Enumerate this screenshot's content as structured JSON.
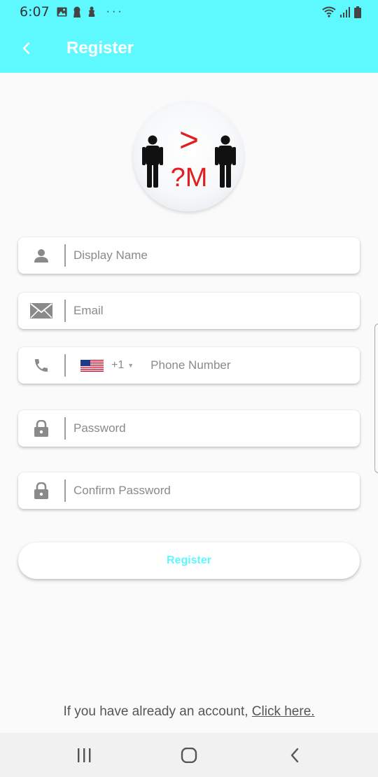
{
  "status_bar": {
    "time": "6:07",
    "left_icons": [
      "gallery-icon",
      "keyhole-icon",
      "figure-icon"
    ],
    "more": "···",
    "right_icons": [
      "wifi-icon",
      "signal-icon",
      "battery-icon"
    ]
  },
  "app_bar": {
    "back_icon": "chevron-left-icon",
    "title": "Register"
  },
  "logo": {
    "symbol_top": ">",
    "symbol_bottom": "?M",
    "accent_color": "#e02020"
  },
  "form": {
    "display_name": {
      "icon": "person-icon",
      "placeholder": "Display Name"
    },
    "email": {
      "icon": "envelope-icon",
      "placeholder": "Email"
    },
    "phone": {
      "icon": "phone-icon",
      "country_flag": "us-flag-icon",
      "country_code": "+1",
      "placeholder": "Phone Number"
    },
    "password": {
      "icon": "lock-icon",
      "placeholder": "Password"
    },
    "confirm_password": {
      "icon": "lock-icon",
      "placeholder": "Confirm Password"
    }
  },
  "register_button": {
    "label": "Register"
  },
  "footer": {
    "prompt": "If you have already an account, ",
    "link": "Click here."
  },
  "nav_bar": {
    "buttons": [
      "recent-apps-icon",
      "home-icon",
      "back-icon"
    ]
  },
  "colors": {
    "accent": "#5ef9ff",
    "background": "#fafafa",
    "placeholder": "#8a8a8a"
  }
}
